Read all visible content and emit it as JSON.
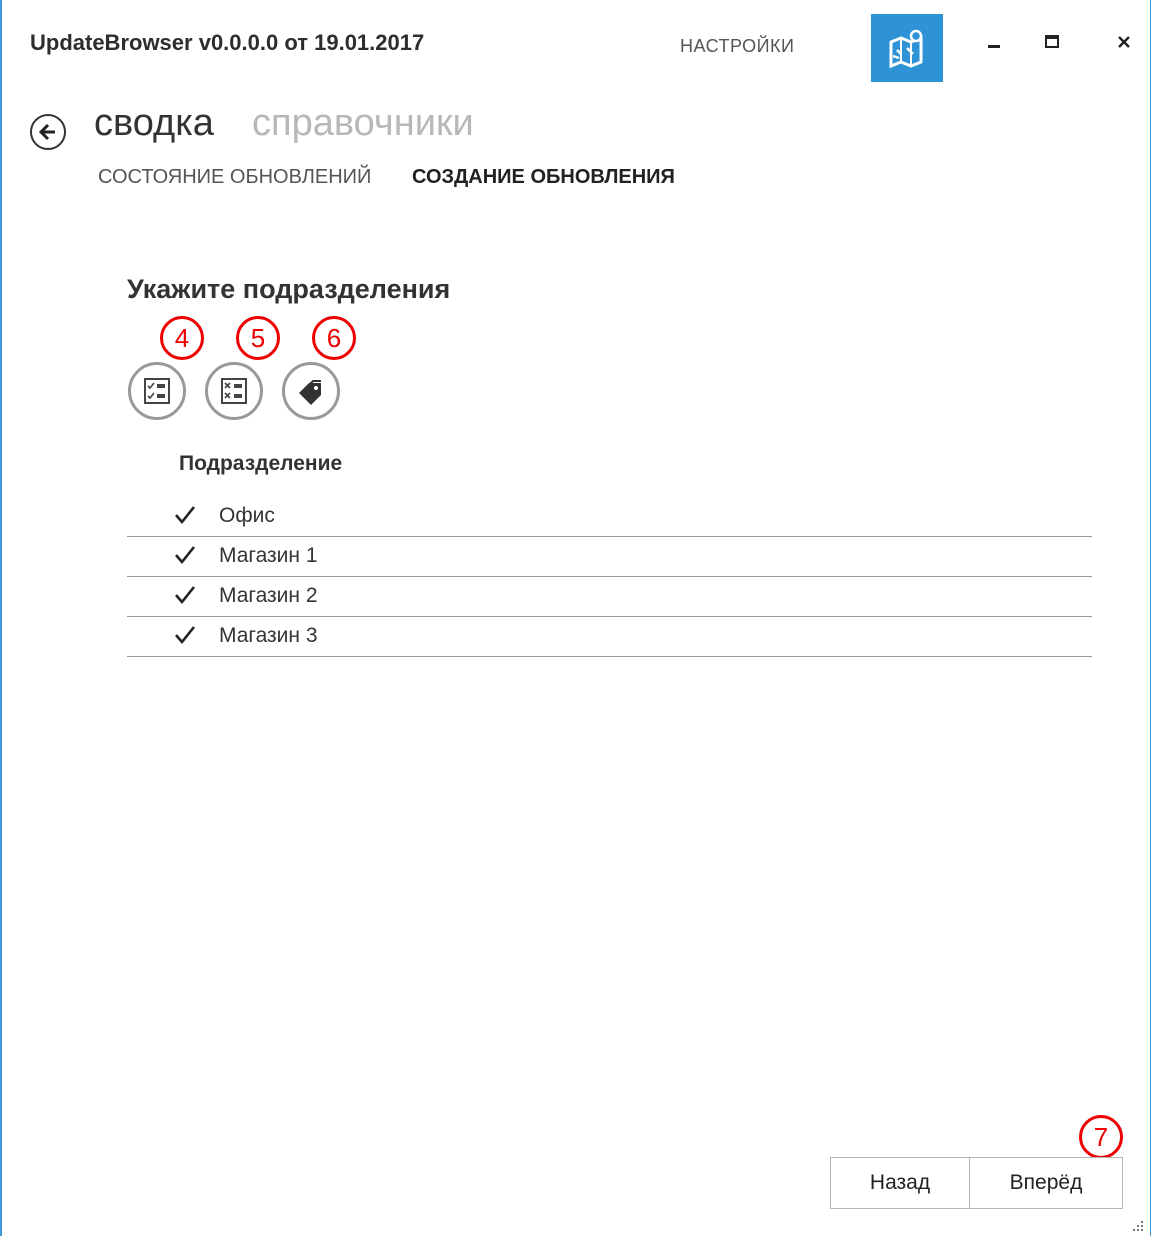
{
  "window": {
    "title": "UpdateBrowser v0.0.0.0 от 19.01.2017",
    "settings_label": "НАСТРОЙКИ",
    "app_icon": "map-pin-icon",
    "controls": [
      "minimize-icon",
      "maximize-icon",
      "close-icon"
    ],
    "accent_color": "#2e92d6"
  },
  "breadcrumb": {
    "back_icon": "arrow-left-icon",
    "active": "сводка",
    "inactive": "справочники"
  },
  "tabs": [
    {
      "label": "СОСТОЯНИЕ ОБНОВЛЕНИЙ",
      "selected": false
    },
    {
      "label": "СОЗДАНИЕ ОБНОВЛЕНИЯ",
      "selected": true
    }
  ],
  "section": {
    "title": "Укажите подразделения",
    "tools": [
      {
        "icon": "select-all-icon",
        "marker": "4"
      },
      {
        "icon": "deselect-all-icon",
        "marker": "5"
      },
      {
        "icon": "tag-icon",
        "marker": "6"
      }
    ]
  },
  "list": {
    "header": "Подразделение",
    "rows": [
      {
        "label": "Офис",
        "checked": true
      },
      {
        "label": "Магазин 1",
        "checked": true
      },
      {
        "label": "Магазин 2",
        "checked": true
      },
      {
        "label": "Магазин 3",
        "checked": true
      }
    ]
  },
  "footer": {
    "back_label": "Назад",
    "next_label": "Вперёд",
    "next_marker": "7"
  }
}
